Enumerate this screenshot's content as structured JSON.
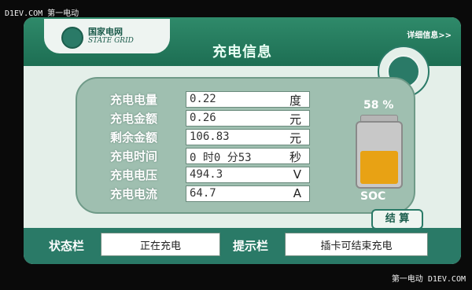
{
  "watermarks": {
    "top": "D1EV.COM 第一电动",
    "bottom": "第一电动 D1EV.COM"
  },
  "header": {
    "logo_cn": "国家电网",
    "logo_en": "STATE GRID",
    "title": "充电信息",
    "detail_link": "详细信息>>"
  },
  "rows": [
    {
      "label": "充电电量",
      "value": "0.22",
      "unit": "度"
    },
    {
      "label": "充电金额",
      "value": "0.26",
      "unit": "元"
    },
    {
      "label": "剩余金额",
      "value": "106.83",
      "unit": "元"
    },
    {
      "label": "充电时间",
      "value": "0  时0  分53",
      "unit": "秒"
    },
    {
      "label": "充电电压",
      "value": "494.3",
      "unit": "V"
    },
    {
      "label": "充电电流",
      "value": "64.7",
      "unit": "A"
    }
  ],
  "battery": {
    "percent_label": "58 %",
    "level": 0.58,
    "soc_label": "SOC",
    "fill_color": "#e8a214"
  },
  "settle_button": "结 算",
  "status": {
    "status_label": "状态栏",
    "status_value": "正在充电",
    "hint_label": "提示栏",
    "hint_value": "插卡可结束充电"
  }
}
